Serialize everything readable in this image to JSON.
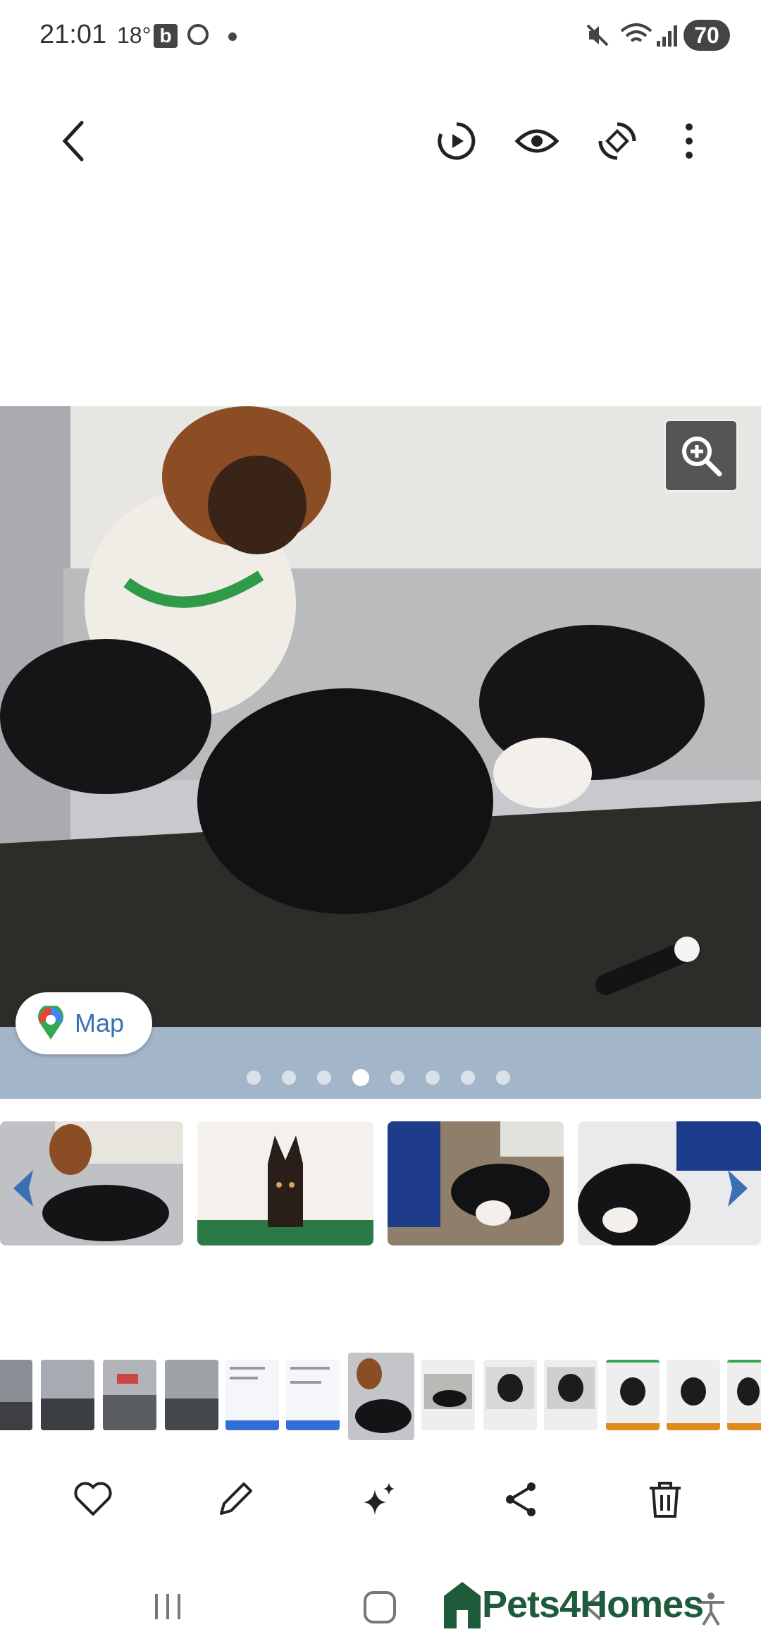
{
  "status_bar": {
    "time": "21:01",
    "temperature": "18°",
    "b_icon_letter": "b",
    "battery": "70"
  },
  "toolbar": {
    "icons": [
      "back-icon",
      "motion-play-icon",
      "eye-icon",
      "rotate-icon",
      "more-options-icon"
    ]
  },
  "photo": {
    "map_label": "Map",
    "page_count": 8,
    "active_page": 4
  },
  "carousel": {
    "prev_icon": "chevron-left-icon",
    "next_icon": "chevron-right-icon",
    "accent_color": "#3b6fb4"
  },
  "filmstrip": {
    "count": 13,
    "current_index": 6
  },
  "actions": {
    "icons": [
      "heart-icon",
      "edit-icon",
      "sparkle-icon",
      "share-icon",
      "delete-icon"
    ]
  },
  "watermark": {
    "brand": "Pets4Homes",
    "color": "#1e5b3a"
  }
}
